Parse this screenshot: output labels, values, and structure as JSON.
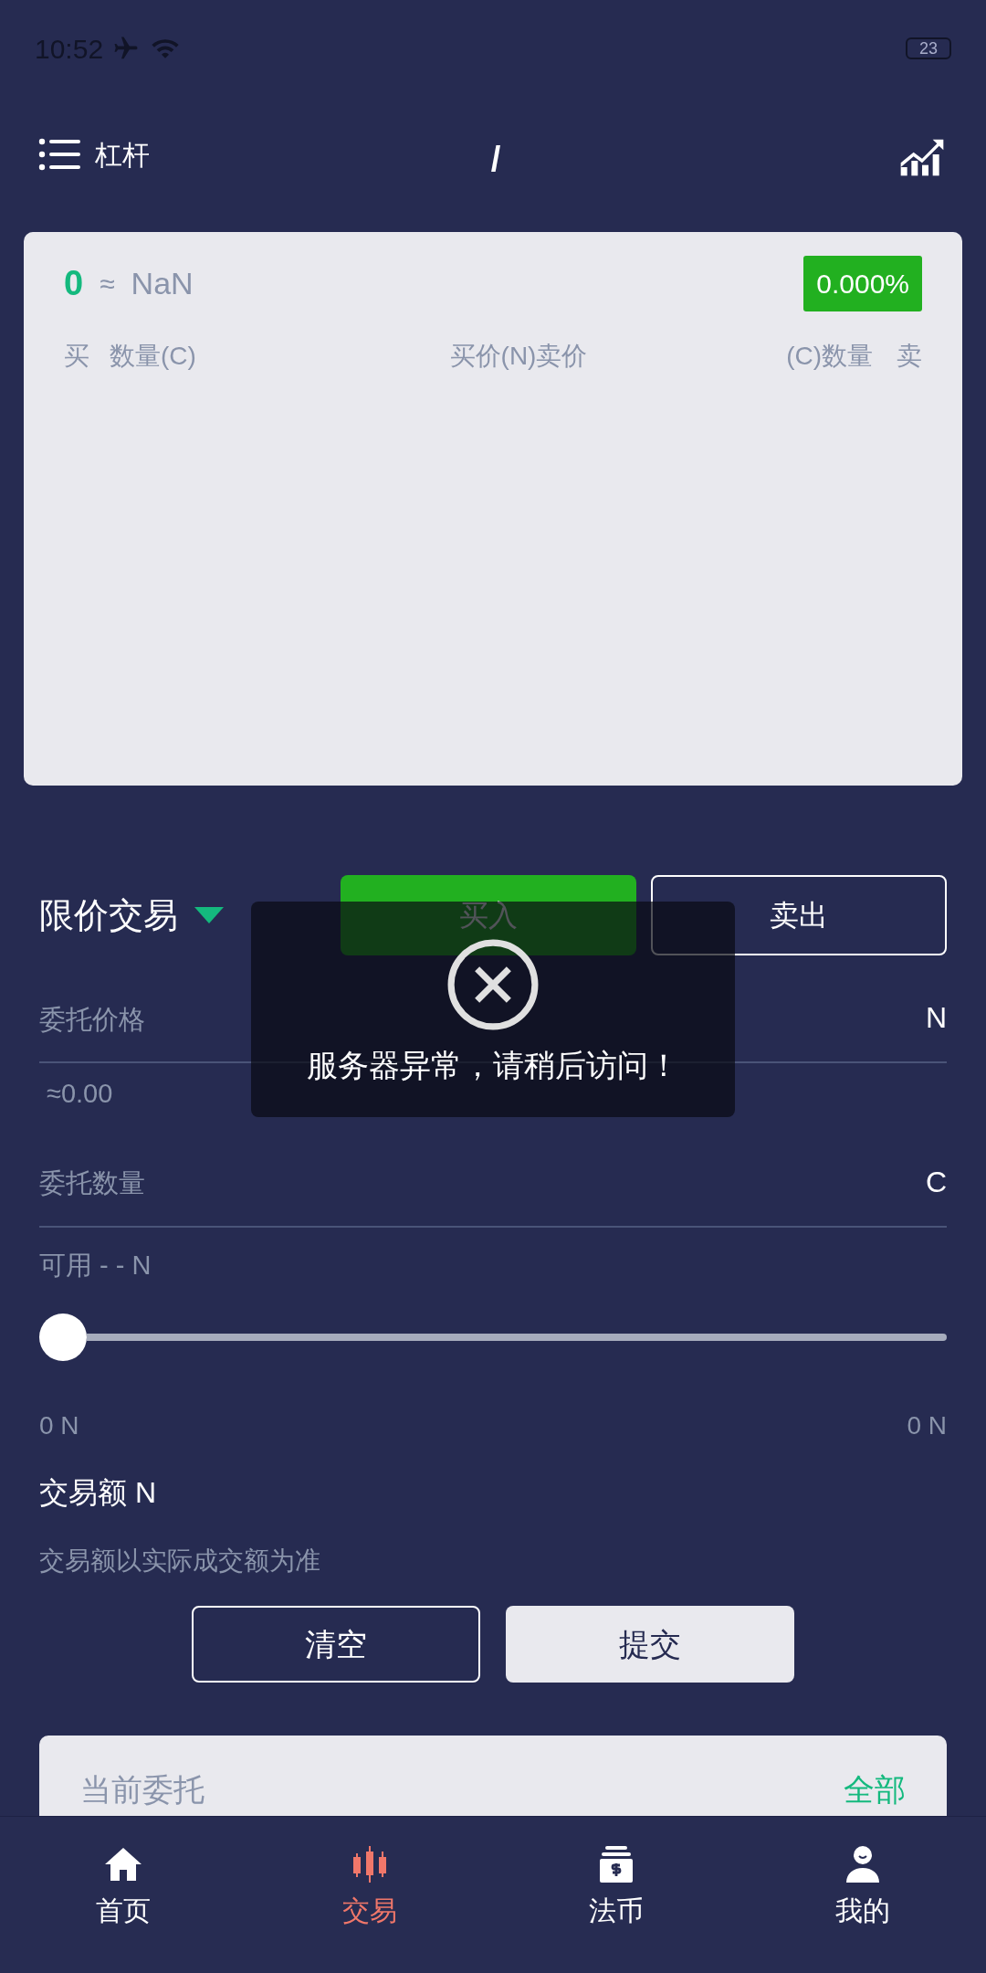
{
  "status_bar": {
    "time": "10:52",
    "battery": "23"
  },
  "header": {
    "menu_label": "杠杆",
    "pair": "/"
  },
  "ticker": {
    "price": "0",
    "approx": "≈",
    "value": "NaN",
    "change": "0.000%"
  },
  "order_book": {
    "columns": [
      "买",
      "数量(C)",
      "买价(N)卖价",
      "(C)数量",
      "卖"
    ]
  },
  "order_type": "限价交易",
  "sides": [
    {
      "label": "买入",
      "selected": true
    },
    {
      "label": "卖出",
      "selected": false
    }
  ],
  "fields": [
    {
      "label": "委托价格",
      "unit": "N",
      "hint": "≈0.00"
    },
    {
      "label": "委托数量",
      "unit": "C"
    }
  ],
  "available": "可用 - - N",
  "slider": {
    "level": 0,
    "min": "0 N",
    "max": "0 N"
  },
  "amount": "交易额 N",
  "note": "交易额以实际成交额为准",
  "actions": [
    {
      "label": "清空",
      "kind": "outline"
    },
    {
      "label": "提交",
      "kind": "solid"
    }
  ],
  "orders": {
    "title": "当前委托",
    "link": "全部"
  },
  "toast": {
    "message": "服务器异常，请稍后访问！"
  },
  "nav": [
    {
      "label": "首页",
      "kind": "home",
      "selected": false
    },
    {
      "label": "交易",
      "kind": "candles",
      "selected": true
    },
    {
      "label": "法币",
      "kind": "cash",
      "selected": false
    },
    {
      "label": "我的",
      "kind": "user",
      "selected": false
    }
  ]
}
